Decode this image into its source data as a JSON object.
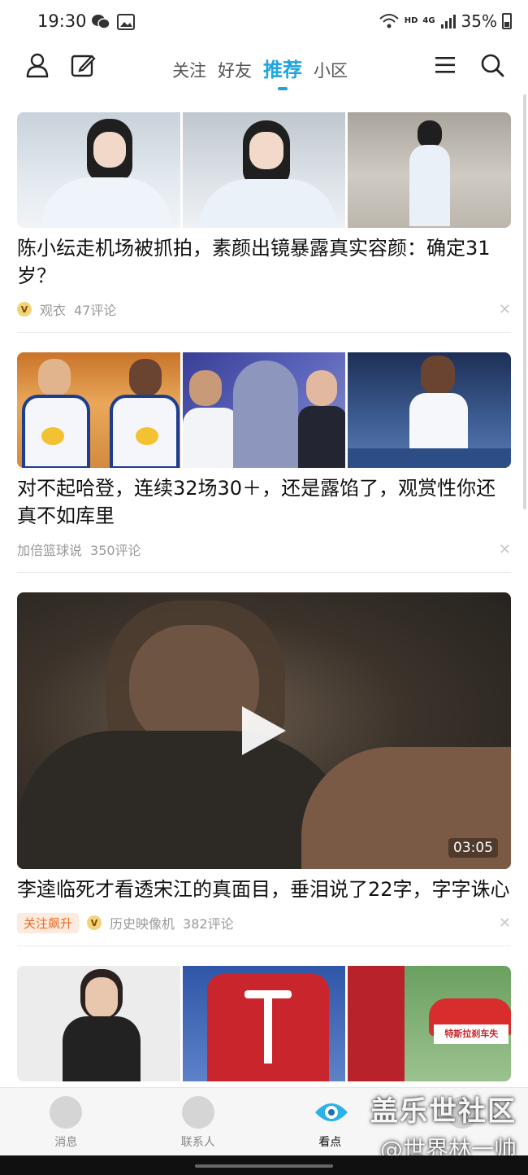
{
  "status_bar": {
    "time": "19:30",
    "network_badge": "HD",
    "network_type": "4G",
    "battery": "35%",
    "icons": [
      "wechat-icon",
      "gallery-icon",
      "wifi-icon",
      "signal-icon",
      "battery-icon"
    ]
  },
  "top_nav": {
    "tabs": [
      {
        "label": "关注",
        "active": false
      },
      {
        "label": "好友",
        "active": false
      },
      {
        "label": "推荐",
        "active": true
      },
      {
        "label": "小区",
        "active": false
      }
    ],
    "accent_color": "#1ea5e0",
    "left_icons": [
      "profile-icon",
      "edit-icon"
    ],
    "right_icons": [
      "menu-icon",
      "search-icon"
    ]
  },
  "feed": [
    {
      "type": "image3",
      "thumbs": [
        {
          "bg": "#dfe7ee",
          "accent": "#2b2b2b"
        },
        {
          "bg": "#d7e0e6",
          "accent": "#2b2b2b"
        },
        {
          "bg": "#c9c7c2",
          "accent": "#2b2b2b"
        }
      ],
      "title": "陈小纭走机场被抓拍，素颜出镜暴露真实容颜：确定31岁？",
      "source": "观衣",
      "comments": "47评论",
      "has_badge": true
    },
    {
      "type": "image3",
      "thumbs": [
        {
          "bg": "#e8a657",
          "accent": "#1e3b8a"
        },
        {
          "bg": "#4d5aa8",
          "accent": "#e6b93a"
        },
        {
          "bg": "#2f4f86",
          "accent": "#ffffff"
        }
      ],
      "title": "对不起哈登，连续32场30＋，还是露馅了，观赏性你还真不如库里",
      "source": "加倍篮球说",
      "comments": "350评论",
      "has_badge": false
    },
    {
      "type": "video",
      "duration": "03:05",
      "title": "李逵临死才看透宋江的真面目，垂泪说了22字，字字诛心",
      "tag": "关注飙升",
      "source": "历史映像机",
      "comments": "382评论",
      "has_badge": true
    },
    {
      "type": "image3",
      "thumbs": [
        {
          "bg": "#e9e9e9",
          "accent": "#222222"
        },
        {
          "bg": "#c8262c",
          "accent": "#ffffff"
        },
        {
          "bg": "#b8222a",
          "accent": "#ffffff"
        }
      ],
      "thumb_caption": "特斯拉刹车失",
      "title": "",
      "source": "",
      "comments": "",
      "has_badge": false
    }
  ],
  "bottom_nav": [
    {
      "label": "消息",
      "active": false,
      "icon": "message-icon"
    },
    {
      "label": "联系人",
      "active": false,
      "icon": "contacts-icon"
    },
    {
      "label": "看点",
      "active": true,
      "icon": "eye-icon"
    },
    {
      "label": "",
      "active": false,
      "icon": "dynamic-icon"
    }
  ],
  "watermark": {
    "line1": "盖乐世社区",
    "line2": "@世界林一帅"
  }
}
